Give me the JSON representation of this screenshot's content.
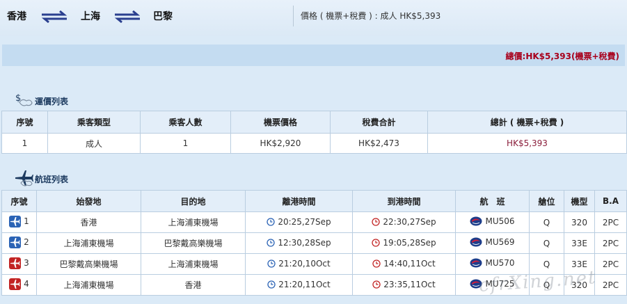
{
  "route": {
    "cities": [
      "香港",
      "上海",
      "巴黎"
    ],
    "price_summary": "價格 ( 機票+稅費 ) : 成人 HK$5,393"
  },
  "total": "總價:HK$5,393(機票+稅費)",
  "fare_section": {
    "title": "運價列表",
    "headers": [
      "序號",
      "乘客類型",
      "乘客人數",
      "機票價格",
      "稅費合計",
      "總計 ( 機票+稅費 )"
    ],
    "rows": [
      [
        "1",
        "成人",
        "1",
        "HK$2,920",
        "HK$2,473",
        "HK$5,393"
      ]
    ]
  },
  "flight_section": {
    "title": "航班列表",
    "headers": [
      "序號",
      "始發地",
      "目的地",
      "離港時間",
      "到港時間",
      "航　班",
      "艙位",
      "機型",
      "B.A"
    ],
    "rows": [
      {
        "no": "1",
        "dir": "depart",
        "from": "香港",
        "to": "上海浦東機場",
        "dep": "20:25,27Sep",
        "arr": "22:30,27Sep",
        "flight": "MU506",
        "cabin": "Q",
        "aircraft": "320",
        "ba": "2PC"
      },
      {
        "no": "2",
        "dir": "depart",
        "from": "上海浦東機場",
        "to": "巴黎戴高樂機場",
        "dep": "12:30,28Sep",
        "arr": "19:05,28Sep",
        "flight": "MU569",
        "cabin": "Q",
        "aircraft": "33E",
        "ba": "2PC"
      },
      {
        "no": "3",
        "dir": "return",
        "from": "巴黎戴高樂機場",
        "to": "上海浦東機場",
        "dep": "21:20,10Oct",
        "arr": "14:40,11Oct",
        "flight": "MU570",
        "cabin": "Q",
        "aircraft": "33E",
        "ba": "2PC"
      },
      {
        "no": "4",
        "dir": "return",
        "from": "上海浦東機場",
        "to": "香港",
        "dep": "21:20,11Oct",
        "arr": "23:35,11Oct",
        "flight": "MU725",
        "cabin": "Q",
        "aircraft": "320",
        "ba": "2PC"
      }
    ]
  },
  "watermark": "cfrXing.net",
  "colors": {
    "accent_blue": "#1c3a5f",
    "total_red": "#a8001c",
    "depart_badge": "#2b63b5",
    "return_badge": "#c22424"
  }
}
